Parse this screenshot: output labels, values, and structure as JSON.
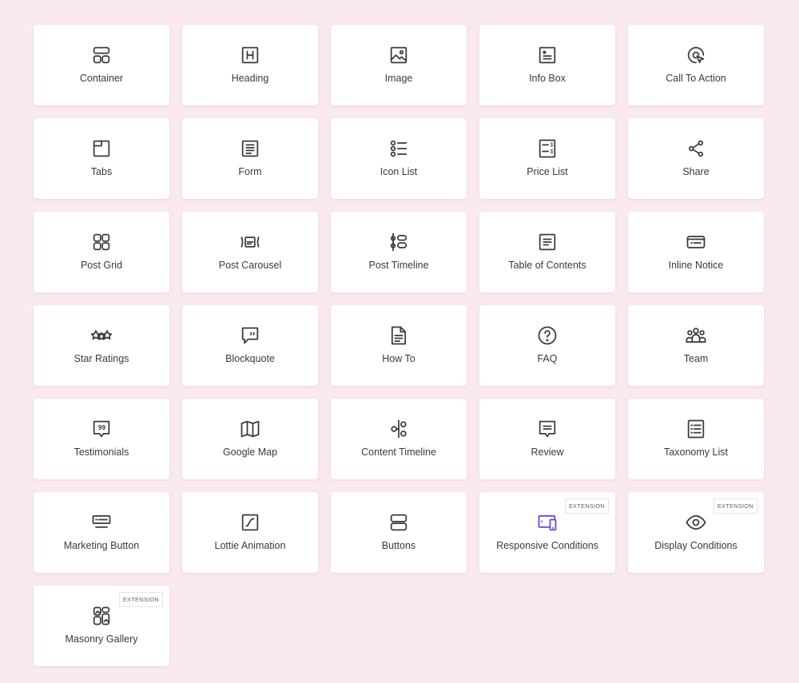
{
  "colors": {
    "background": "#fbe9f1",
    "icon": "#3a3a3a",
    "accent": "#6b3fd4"
  },
  "badge_label": "EXTENSION",
  "widgets": [
    {
      "label": "Container",
      "icon": "container-icon"
    },
    {
      "label": "Heading",
      "icon": "heading-icon"
    },
    {
      "label": "Image",
      "icon": "image-icon"
    },
    {
      "label": "Info Box",
      "icon": "info-box-icon"
    },
    {
      "label": "Call To Action",
      "icon": "cursor-click-icon"
    },
    {
      "label": "Tabs",
      "icon": "tabs-icon"
    },
    {
      "label": "Form",
      "icon": "form-icon"
    },
    {
      "label": "Icon List",
      "icon": "icon-list-icon"
    },
    {
      "label": "Price List",
      "icon": "price-list-icon"
    },
    {
      "label": "Share",
      "icon": "share-icon"
    },
    {
      "label": "Post Grid",
      "icon": "post-grid-icon"
    },
    {
      "label": "Post Carousel",
      "icon": "post-carousel-icon"
    },
    {
      "label": "Post Timeline",
      "icon": "post-timeline-icon"
    },
    {
      "label": "Table of Contents",
      "icon": "table-of-contents-icon"
    },
    {
      "label": "Inline Notice",
      "icon": "inline-notice-icon"
    },
    {
      "label": "Star Ratings",
      "icon": "star-ratings-icon"
    },
    {
      "label": "Blockquote",
      "icon": "blockquote-icon"
    },
    {
      "label": "How To",
      "icon": "how-to-icon"
    },
    {
      "label": "FAQ",
      "icon": "faq-icon"
    },
    {
      "label": "Team",
      "icon": "team-icon"
    },
    {
      "label": "Testimonials",
      "icon": "testimonials-icon"
    },
    {
      "label": "Google Map",
      "icon": "map-icon"
    },
    {
      "label": "Content Timeline",
      "icon": "content-timeline-icon"
    },
    {
      "label": "Review",
      "icon": "review-icon"
    },
    {
      "label": "Taxonomy List",
      "icon": "taxonomy-list-icon"
    },
    {
      "label": "Marketing Button",
      "icon": "marketing-button-icon"
    },
    {
      "label": "Lottie Animation",
      "icon": "lottie-icon"
    },
    {
      "label": "Buttons",
      "icon": "buttons-icon"
    },
    {
      "label": "Responsive Conditions",
      "icon": "responsive-devices-icon",
      "extension": true,
      "accent": true
    },
    {
      "label": "Display Conditions",
      "icon": "eye-icon",
      "extension": true
    },
    {
      "label": "Masonry Gallery",
      "icon": "masonry-gallery-icon",
      "extension": true
    }
  ]
}
